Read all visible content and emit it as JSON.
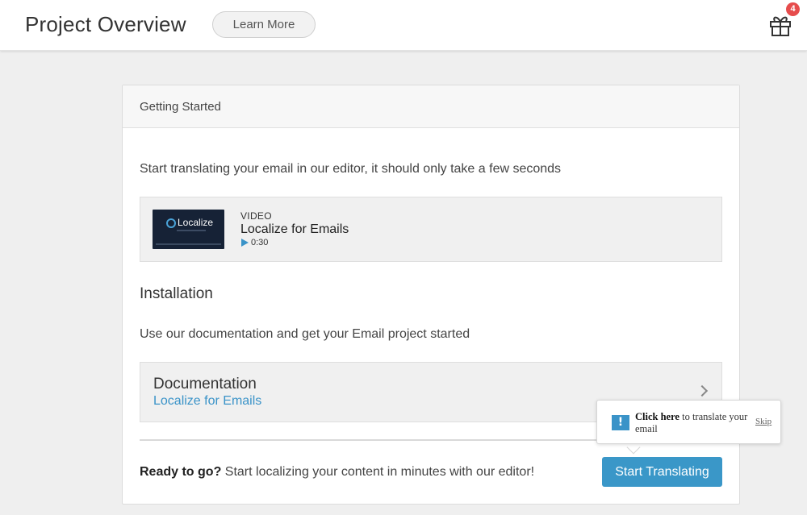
{
  "header": {
    "title": "Project Overview",
    "learn_more_label": "Learn More",
    "gift_badge_count": "4"
  },
  "card": {
    "header_title": "Getting Started",
    "intro_text": "Start translating your email in our editor, it should only take a few seconds",
    "video": {
      "thumbnail_text": "Localize",
      "label": "VIDEO",
      "title": "Localize for Emails",
      "duration": "0:30"
    },
    "installation": {
      "heading": "Installation",
      "text": "Use our documentation and get your Email project started"
    },
    "documentation": {
      "title": "Documentation",
      "link_text": "Localize for Emails"
    },
    "footer": {
      "ready_bold": "Ready to go?",
      "ready_rest": " Start localizing your content in minutes with our editor!",
      "start_button_label": "Start Translating"
    }
  },
  "tooltip": {
    "bold_text": "Click here",
    "rest_text": " to translate your email",
    "skip_label": "Skip"
  },
  "colors": {
    "accent": "#3a97c8",
    "badge": "#e64c4c",
    "background": "#efefef"
  }
}
